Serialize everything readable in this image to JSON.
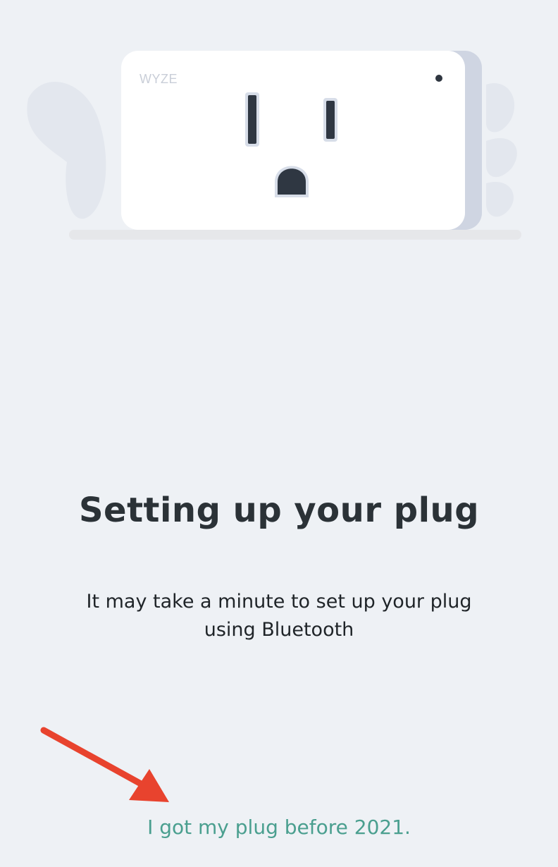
{
  "illustration": {
    "logo_text": "WYZE"
  },
  "setup": {
    "title": "Setting up your plug",
    "subtitle": "It may take a minute to set up your plug using Bluetooth",
    "legacy_link": "I got my plug before 2021."
  },
  "colors": {
    "background": "#eef1f5",
    "title": "#2b3237",
    "link": "#4a9f8f",
    "annotation_arrow": "#e8432e"
  }
}
